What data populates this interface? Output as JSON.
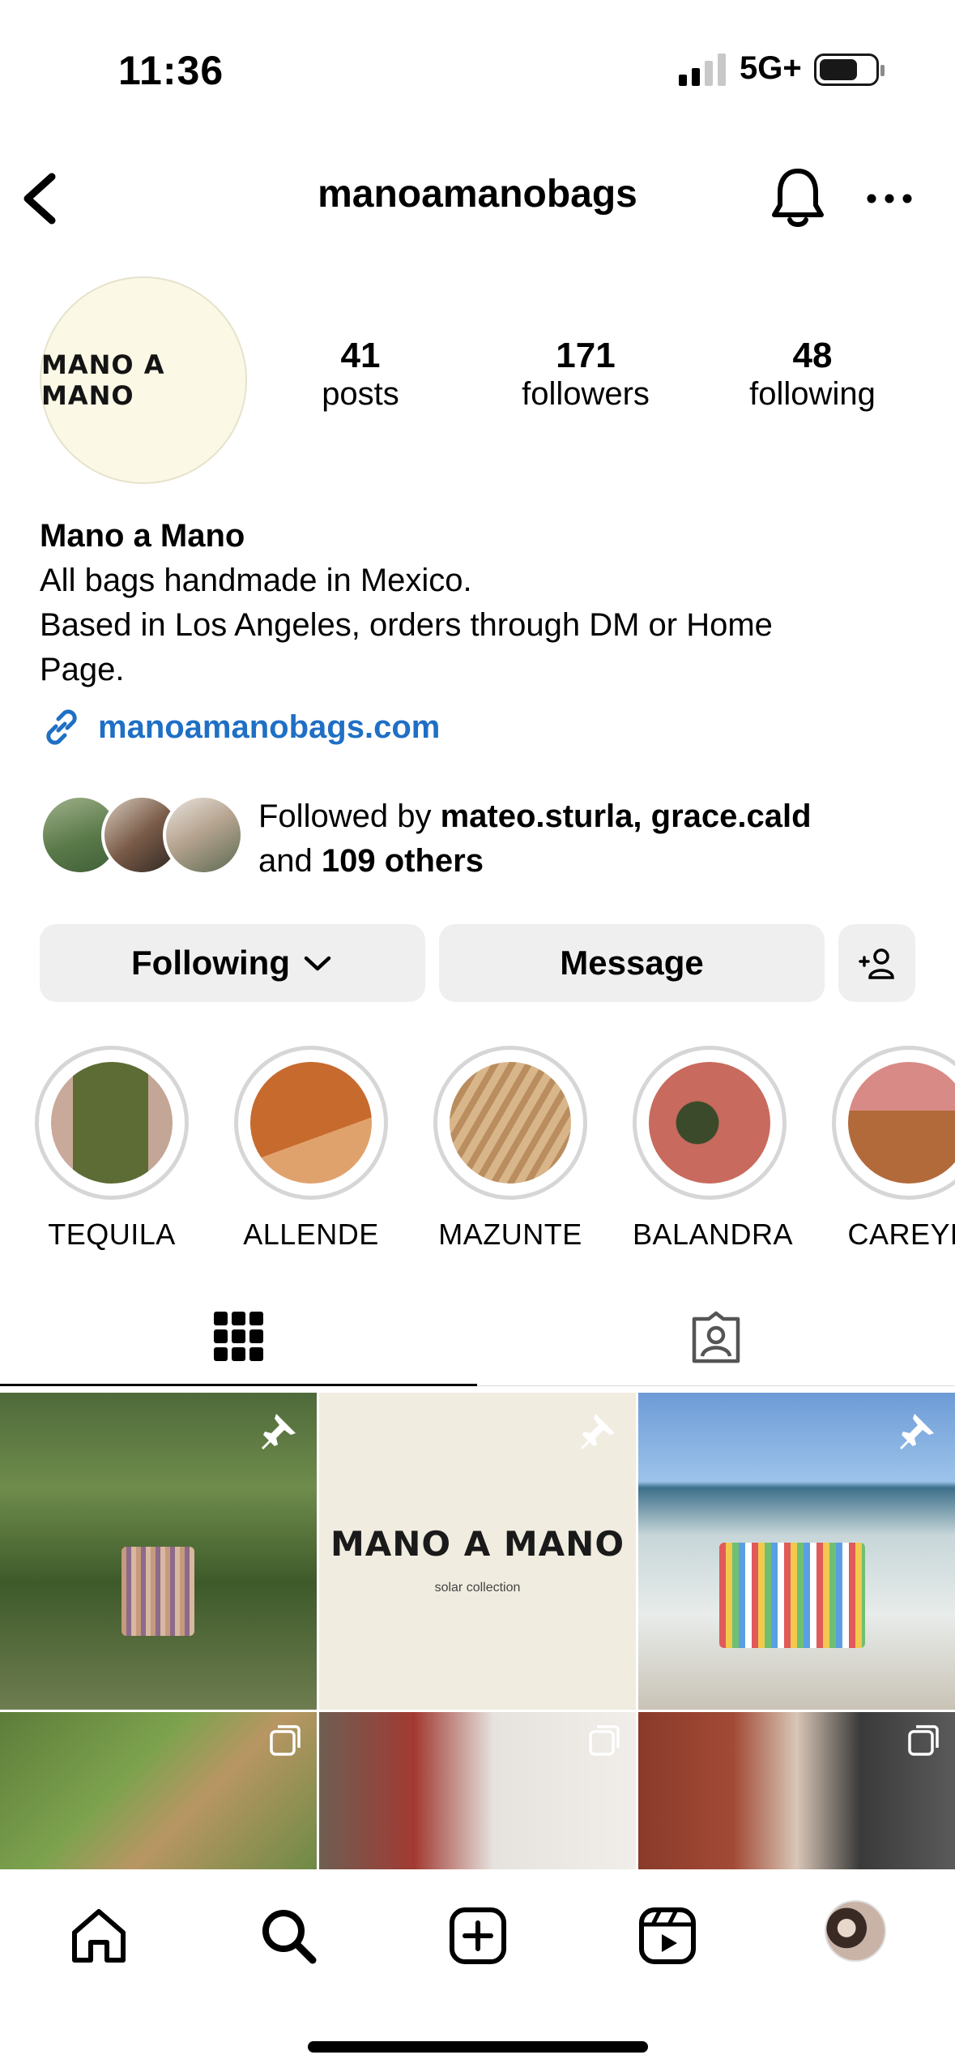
{
  "status_bar": {
    "time": "11:36",
    "network": "5G+"
  },
  "header": {
    "handle": "manoamanobags"
  },
  "profile": {
    "avatar_text": "MANO A MANO",
    "stats": [
      {
        "value": "41",
        "label": "posts"
      },
      {
        "value": "171",
        "label": "followers"
      },
      {
        "value": "48",
        "label": "following"
      }
    ],
    "name": "Mano a Mano",
    "bio_lines": [
      "All bags handmade in Mexico.",
      "Based in Los Angeles, orders through DM or Home",
      "Page."
    ],
    "link": "manoamanobags.com",
    "followed_by": {
      "prefix": "Followed by ",
      "users": "mateo.sturla, grace.cald",
      "and": "and ",
      "others": "109 others"
    }
  },
  "buttons": {
    "following": "Following",
    "message": "Message"
  },
  "highlights": [
    {
      "label": "TEQUILA"
    },
    {
      "label": "ALLENDE"
    },
    {
      "label": "MAZUNTE"
    },
    {
      "label": "BALANDRA"
    },
    {
      "label": "CAREYE"
    }
  ],
  "grid_posts": [
    {
      "pinned": true,
      "text": ""
    },
    {
      "pinned": true,
      "text": "MANO A MANO",
      "subtext": "solar collection"
    },
    {
      "pinned": true,
      "text": ""
    },
    {
      "multi": true
    },
    {
      "multi": true
    },
    {
      "multi": true
    }
  ],
  "colors": {
    "link": "#1f6fc5",
    "button_bg": "#efefef",
    "ring": "#d6d6d6",
    "avatar_bg": "#fbf8e6"
  },
  "icons": [
    "back-chevron-icon",
    "bell-icon",
    "more-icon",
    "link-icon",
    "chevron-down-icon",
    "add-person-icon",
    "grid-icon",
    "tagged-icon",
    "pin-icon",
    "multi-post-icon",
    "home-icon",
    "search-icon",
    "create-icon",
    "reels-icon"
  ]
}
